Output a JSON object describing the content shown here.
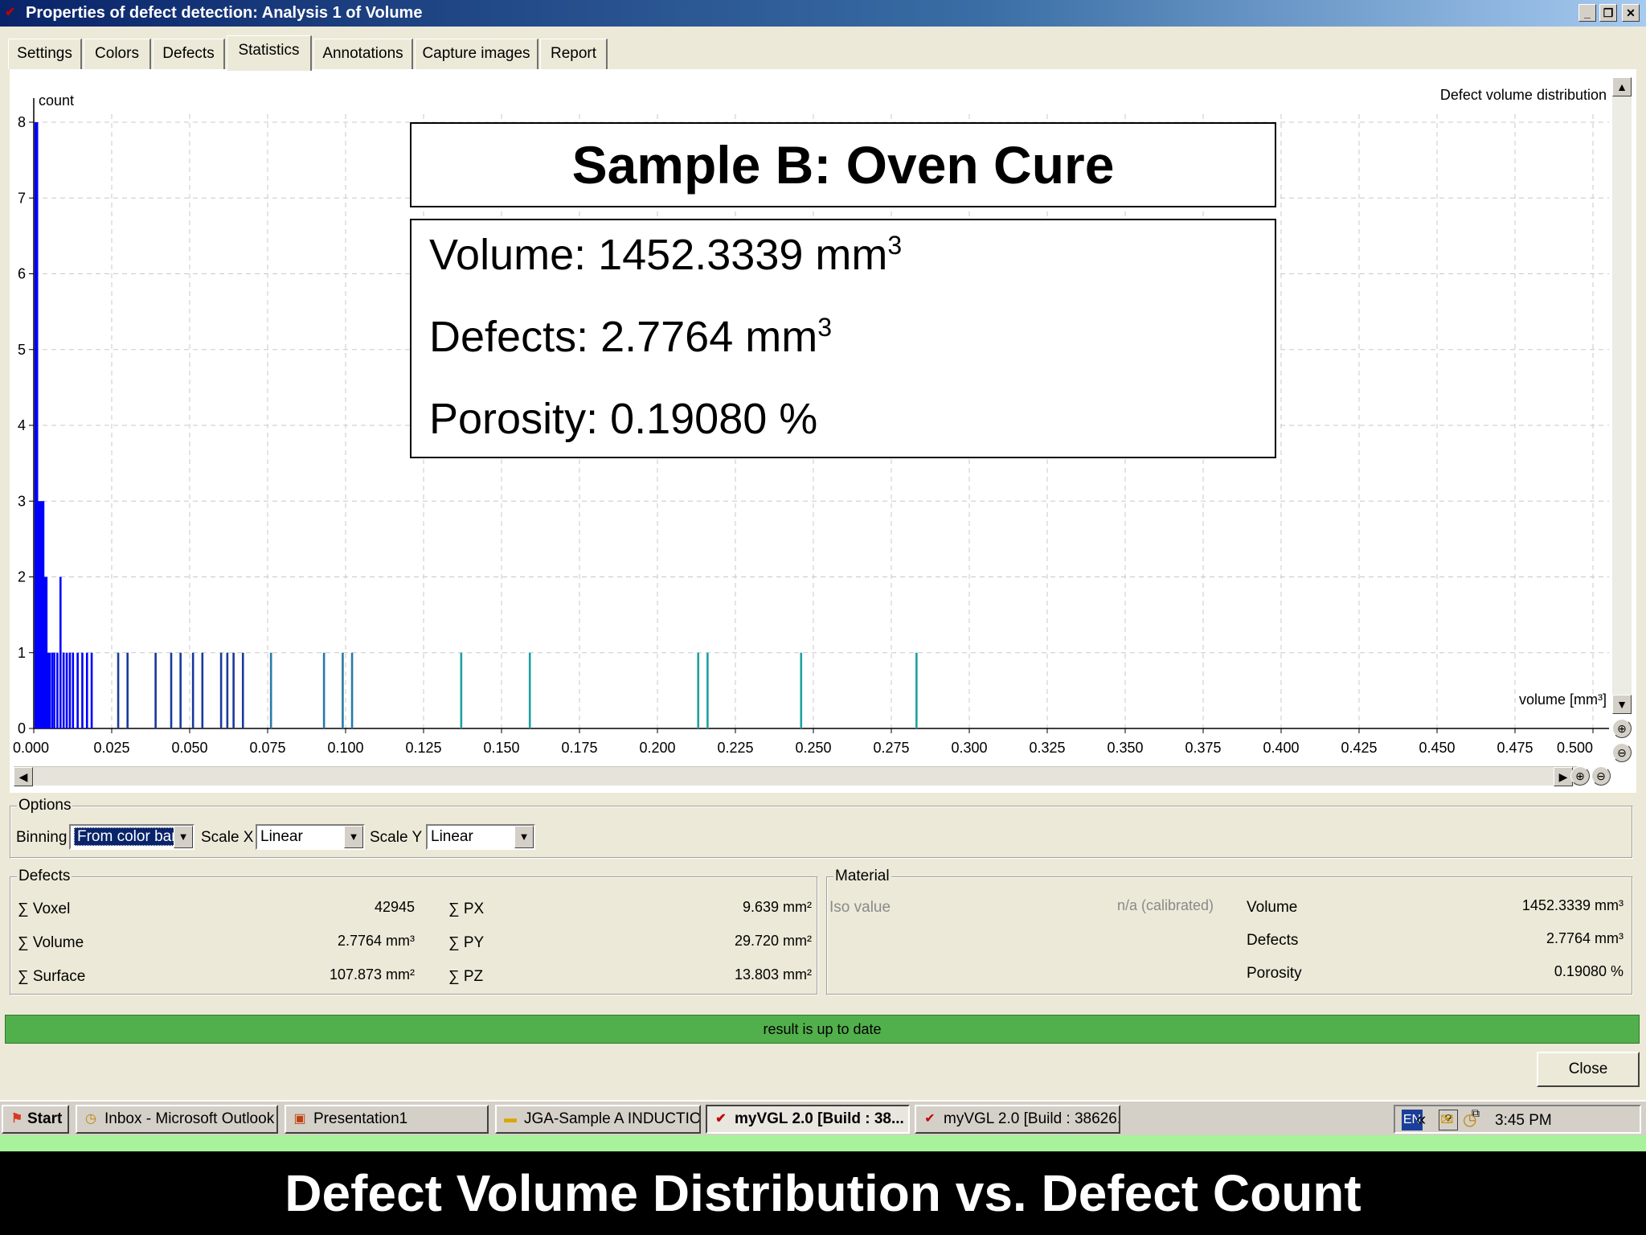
{
  "window": {
    "title": "Properties of defect detection: Analysis 1 of Volume",
    "controls": {
      "minimize": "_",
      "restore": "❐",
      "close": "✕"
    }
  },
  "tabs": [
    {
      "label": "Settings"
    },
    {
      "label": "Colors"
    },
    {
      "label": "Defects"
    },
    {
      "label": "Statistics",
      "active": true
    },
    {
      "label": "Annotations"
    },
    {
      "label": "Capture images"
    },
    {
      "label": "Report"
    }
  ],
  "chart_data": {
    "type": "bar",
    "title": "Defect volume distribution",
    "xlabel": "volume [mm³]",
    "ylabel": "count",
    "xlim": [
      0,
      0.5
    ],
    "ylim": [
      0,
      8
    ],
    "grid": true,
    "x_ticks": [
      "0.000",
      "0.025",
      "0.050",
      "0.075",
      "0.100",
      "0.125",
      "0.150",
      "0.175",
      "0.200",
      "0.225",
      "0.250",
      "0.275",
      "0.300",
      "0.325",
      "0.350",
      "0.375",
      "0.400",
      "0.425",
      "0.450",
      "0.475",
      "0.500"
    ],
    "y_ticks": [
      "0",
      "1",
      "2",
      "3",
      "4",
      "5",
      "6",
      "7",
      "8"
    ],
    "series": [
      {
        "color": "#0000ff",
        "points": [
          {
            "x": 0.0005,
            "y": 8
          },
          {
            "x": 0.001,
            "y": 8
          },
          {
            "x": 0.0015,
            "y": 3
          },
          {
            "x": 0.002,
            "y": 3
          },
          {
            "x": 0.0025,
            "y": 3
          },
          {
            "x": 0.003,
            "y": 3
          },
          {
            "x": 0.0035,
            "y": 2
          },
          {
            "x": 0.004,
            "y": 2
          },
          {
            "x": 0.0045,
            "y": 1
          },
          {
            "x": 0.005,
            "y": 1
          },
          {
            "x": 0.0058,
            "y": 1
          },
          {
            "x": 0.0065,
            "y": 1
          },
          {
            "x": 0.0075,
            "y": 1
          },
          {
            "x": 0.0085,
            "y": 2
          },
          {
            "x": 0.0095,
            "y": 1
          },
          {
            "x": 0.0105,
            "y": 1
          },
          {
            "x": 0.0115,
            "y": 1
          },
          {
            "x": 0.0125,
            "y": 1
          },
          {
            "x": 0.014,
            "y": 1
          },
          {
            "x": 0.0155,
            "y": 1
          },
          {
            "x": 0.017,
            "y": 1
          },
          {
            "x": 0.0185,
            "y": 1
          }
        ]
      },
      {
        "color": "#1a3a9a",
        "points": [
          {
            "x": 0.027,
            "y": 1
          },
          {
            "x": 0.03,
            "y": 1
          },
          {
            "x": 0.039,
            "y": 1
          },
          {
            "x": 0.044,
            "y": 1
          },
          {
            "x": 0.047,
            "y": 1
          },
          {
            "x": 0.051,
            "y": 1
          },
          {
            "x": 0.054,
            "y": 1
          },
          {
            "x": 0.06,
            "y": 1
          },
          {
            "x": 0.062,
            "y": 1
          },
          {
            "x": 0.064,
            "y": 1
          },
          {
            "x": 0.067,
            "y": 1
          }
        ]
      },
      {
        "color": "#2a7aa8",
        "points": [
          {
            "x": 0.076,
            "y": 1
          },
          {
            "x": 0.093,
            "y": 1
          },
          {
            "x": 0.099,
            "y": 1
          },
          {
            "x": 0.102,
            "y": 1
          }
        ]
      },
      {
        "color": "#1fa0a0",
        "points": [
          {
            "x": 0.137,
            "y": 1
          },
          {
            "x": 0.159,
            "y": 1
          },
          {
            "x": 0.213,
            "y": 1
          },
          {
            "x": 0.216,
            "y": 1
          },
          {
            "x": 0.246,
            "y": 1
          },
          {
            "x": 0.283,
            "y": 1
          }
        ]
      }
    ]
  },
  "overlay": {
    "title": "Sample B: Oven Cure",
    "volume_label": "Volume: 1452.3339 mm",
    "defects_label": "Defects: 2.7764 mm",
    "porosity_label": "Porosity: 0.19080 %",
    "superscript": "3"
  },
  "options": {
    "legend": "Options",
    "binning_label": "Binning",
    "binning_value": "From color bar",
    "scale_x_label": "Scale X",
    "scale_x_value": "Linear",
    "scale_y_label": "Scale Y",
    "scale_y_value": "Linear"
  },
  "defects": {
    "legend": "Defects",
    "rows": [
      {
        "label": "∑ Voxel",
        "value": "42945",
        "label2": "∑ PX",
        "value2": "9.639 mm²"
      },
      {
        "label": "∑ Volume",
        "value": "2.7764 mm³",
        "label2": "∑ PY",
        "value2": "29.720 mm²"
      },
      {
        "label": "∑ Surface",
        "value": "107.873 mm²",
        "label2": "∑ PZ",
        "value2": "13.803 mm²"
      }
    ]
  },
  "material": {
    "legend": "Material",
    "iso_label": "Iso value",
    "iso_value": "n/a (calibrated)",
    "rows": [
      {
        "label": "Volume",
        "value": "1452.3339 mm³"
      },
      {
        "label": "Defects",
        "value": "2.7764 mm³"
      },
      {
        "label": "Porosity",
        "value": "0.19080 %"
      }
    ]
  },
  "status": {
    "text": "result is up to date"
  },
  "close_label": "Close",
  "taskbar": {
    "start_label": "Start",
    "items": [
      {
        "label": "Inbox - Microsoft Outlook",
        "icon": "clock-icon"
      },
      {
        "label": "Presentation1",
        "icon": "powerpoint-icon"
      },
      {
        "label": "JGA-Sample A INDUCTIO...",
        "icon": "folder-icon"
      },
      {
        "label": "myVGL 2.0 [Build : 38...",
        "icon": "myvgl-icon",
        "active": true
      },
      {
        "label": "myVGL 2.0 [Build : 38626...",
        "icon": "myvgl-icon"
      }
    ],
    "language": "EN",
    "clock": "3:45 PM"
  },
  "caption": "Defect Volume Distribution vs. Defect Count",
  "colors": {
    "status_green": "#52b04c",
    "titlebar_blue": "#0a246a",
    "bar_blue": "#0000ff",
    "bar_teal": "#1fa0a0"
  }
}
